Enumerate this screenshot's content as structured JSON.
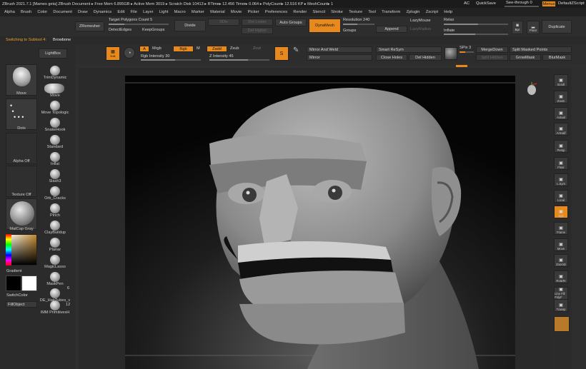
{
  "titlebar": {
    "text": "ZBrush 2021.7.1 [Mames geta]   ZBrush Document     ▸ Free Mem 6.895GB ▸ Active Mem 3019 ▸ Scratch Disk 10413 ▸ RTime▸ 12.456 Timer▸ 0.064 ▸ PolyCount▸ 12.516 KP ▸ MeshCount▸ 1",
    "ac": "AC",
    "quicksave": "QuickSave",
    "see_through": "See-through  0",
    "menus_btn": "Menus",
    "default_script": "DefaultZScript"
  },
  "menubar": [
    "Alpha",
    "Brush",
    "Color",
    "Document",
    "Draw",
    "Dynamics",
    "Edit",
    "File",
    "Layer",
    "Light",
    "Macro",
    "Marker",
    "Material",
    "Movie",
    "Picker",
    "Preferences",
    "Render",
    "Stencil",
    "Stroke",
    "Texture",
    "Tool",
    "Transform",
    "Zplugin",
    "Zscript",
    "Help"
  ],
  "toolbar": {
    "zremesher": "ZRemesher",
    "target_polys": "Target Polygons Count 5",
    "detect_edges": "DetectEdges",
    "keep_groups": "KeepGroups",
    "divide": "Divide",
    "sdiv": "SDiv",
    "del_lower": "Del Lower",
    "del_higher": "Del Higher",
    "auto_groups": "Auto Groups",
    "dynamesh": "DynaMesh",
    "resolution": "Resolution 240",
    "groups": "Groups",
    "append": "Append",
    "lazymouse": "LazyMouse",
    "lazyradius": "LazyRadius",
    "relax": "Relax",
    "inflate": "Inflate",
    "bpr": "Bpr",
    "floor": "Floor",
    "duplicate": "Duplicate"
  },
  "subbar": {
    "status": "Switching to Subtool 4:",
    "subtool": "Browbone",
    "lightbox": "LightBox"
  },
  "shelf": {
    "edit": "Edit",
    "draw_icon": "S",
    "a": "A",
    "mrgb": "Mrgb",
    "rgb": "Rgb",
    "m": "M",
    "zadd": "Zadd",
    "zsub": "Zsub",
    "zcut": "Zcut",
    "rgb_intensity": "Rgb Intensity 30",
    "z_intensity": "Z Intensity 45",
    "mirror_weld": "Mirror And Weld",
    "mirror": "Mirror",
    "smart_resym": "Smart ReSym",
    "close_holes": "Close Holes",
    "del_hidden": "Del Hidden",
    "spix": "SPix 3",
    "merge_down": "MergeDown",
    "split_hidden": "Split Hidden",
    "split_masked": "Split Masked Points",
    "grow_mask": "GrowMask",
    "blur_mask": "BlurMask"
  },
  "leftpanel": {
    "move_big": "Move",
    "dots": "Dots",
    "alpha_off": "Alpha Off",
    "texture_off": "Texture Off",
    "matcap": "MatCap Gray",
    "gradient": "Gradient",
    "switch_color": "SwitchColor",
    "fill_object": "FillObject",
    "brushes": [
      "TrimDynamic",
      "Move",
      "Move Topologic",
      "SnakeHook",
      "Standard",
      "Inflat",
      "Slash3",
      "Orb_Cracks",
      "Pinch",
      "ClayBuildup",
      "Planar",
      "MagicLasso",
      "MaskPen",
      "DE_HairTubes_v",
      "IMM PrimitivesH"
    ],
    "count_6": "6",
    "count_12": "12"
  },
  "rightpanel": [
    "Scroll",
    "Zoom",
    "Actual",
    "AAHalf",
    "Persp",
    "Floor",
    "L.Sym",
    "Local",
    "Xyz",
    "Frame",
    "Move",
    "ZoomD",
    "RotaTe",
    "Line Fill PolyF",
    "Transp"
  ],
  "colors": {
    "accent": "#e8891d",
    "bg": "#2a2a2a"
  }
}
